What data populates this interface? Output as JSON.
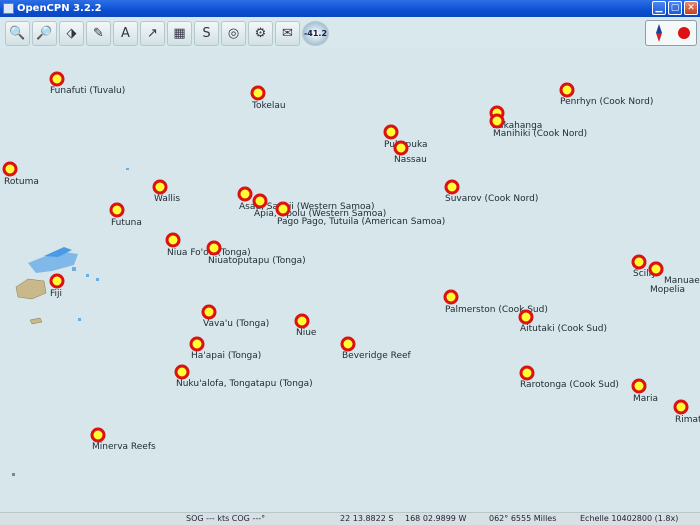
{
  "window": {
    "title": "OpenCPN 3.2.2",
    "controls": [
      "minimize-icon",
      "maximize-icon",
      "close-icon"
    ]
  },
  "toolbar": {
    "buttons": [
      {
        "name": "zoom-in-button",
        "icon": "zoom-in-icon",
        "glyph": "🔍"
      },
      {
        "name": "zoom-out-button",
        "icon": "zoom-out-icon",
        "glyph": "🔎"
      },
      {
        "name": "scale-in-button",
        "icon": "chart-scale-icon",
        "glyph": "⬗"
      },
      {
        "name": "pan-button",
        "icon": "pencil-icon",
        "glyph": "✎"
      },
      {
        "name": "text-button",
        "icon": "text-icon",
        "glyph": "A"
      },
      {
        "name": "route-button",
        "icon": "route-icon",
        "glyph": "↗"
      },
      {
        "name": "chart-button",
        "icon": "chart-icon",
        "glyph": "▦"
      },
      {
        "name": "track-button",
        "icon": "track-icon",
        "glyph": "S"
      },
      {
        "name": "mob-button",
        "icon": "lifebuoy-icon",
        "glyph": "◎"
      },
      {
        "name": "ais-button",
        "icon": "ais-icon",
        "glyph": "⚙"
      },
      {
        "name": "settings-button",
        "icon": "settings-icon",
        "glyph": "✉"
      }
    ],
    "zoom_readout": "-41.2"
  },
  "places": [
    {
      "name": "Funafuti (Tuvalu)"
    },
    {
      "name": "Tokelau"
    },
    {
      "name": "Penrhyn (Cook Nord)"
    },
    {
      "name": "Rakahanga"
    },
    {
      "name": "Manihiki (Cook Nord)"
    },
    {
      "name": "Pukapuka"
    },
    {
      "name": "Nassau"
    },
    {
      "name": "Rotuma"
    },
    {
      "name": "Wallis"
    },
    {
      "name": "Asau, Savaii (Western Samoa)"
    },
    {
      "name": "Apia, Upolu (Western Samoa)"
    },
    {
      "name": "Pago Pago, Tutuila (American Samoa)"
    },
    {
      "name": "Suvarov (Cook Nord)"
    },
    {
      "name": "Futuna"
    },
    {
      "name": "Niua Fo'ou (Tonga)"
    },
    {
      "name": "Niuatoputapu (Tonga)"
    },
    {
      "name": "Fiji"
    },
    {
      "name": "Scilly"
    },
    {
      "name": "Manuae"
    },
    {
      "name": "Mopelia"
    },
    {
      "name": "Palmerston (Cook Sud)"
    },
    {
      "name": "Aitutaki (Cook Sud)"
    },
    {
      "name": "Vava'u (Tonga)"
    },
    {
      "name": "Niue"
    },
    {
      "name": "Beveridge Reef"
    },
    {
      "name": "Ha'apai (Tonga)"
    },
    {
      "name": "Nuku'alofa, Tongatapu (Tonga)"
    },
    {
      "name": "Rarotonga (Cook Sud)"
    },
    {
      "name": "Maria"
    },
    {
      "name": "Rimatara"
    },
    {
      "name": "Minerva Reefs"
    }
  ],
  "status": {
    "sog": "SOG --- kts  COG ---°",
    "lat": "22 13.8822 S",
    "lon": "168 02.9899 W",
    "bearing_distance": "062°  6555 Milles",
    "scale": "Echelle 10402800 (1.8x)"
  },
  "colors": {
    "sea": "#d6e6ea",
    "land": "#c9b98a",
    "shoal": "#6aaee8",
    "marker_fill": "#ffff33",
    "marker_ring": "#dd1111",
    "titlebar": "#0b4fd0"
  }
}
